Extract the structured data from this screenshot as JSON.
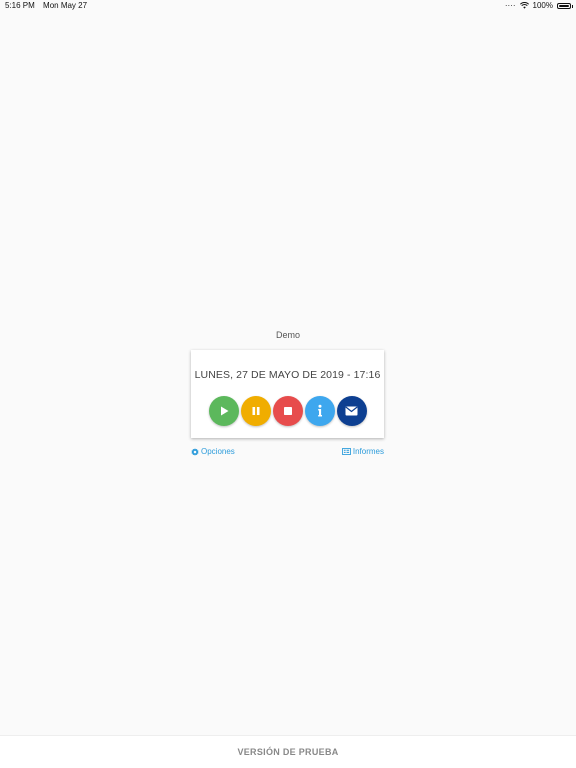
{
  "status_bar": {
    "time": "5:16 PM",
    "date": "Mon May 27",
    "battery": "100%",
    "signal": "····"
  },
  "title": "Demo",
  "card": {
    "datetime": "LUNES, 27 DE MAYO DE 2019 - 17:16"
  },
  "actions": [
    {
      "icon": "play-icon",
      "color": "#5cb85c"
    },
    {
      "icon": "pause-icon",
      "color": "#f0ad00"
    },
    {
      "icon": "stop-icon",
      "color": "#e74c4c"
    },
    {
      "icon": "info-icon",
      "color": "#3ea7ee"
    },
    {
      "icon": "mail-icon",
      "color": "#0d3f91"
    }
  ],
  "links": {
    "options": "Opciones",
    "reports": "Informes"
  },
  "footer": "VERSIÓN DE PRUEBA"
}
